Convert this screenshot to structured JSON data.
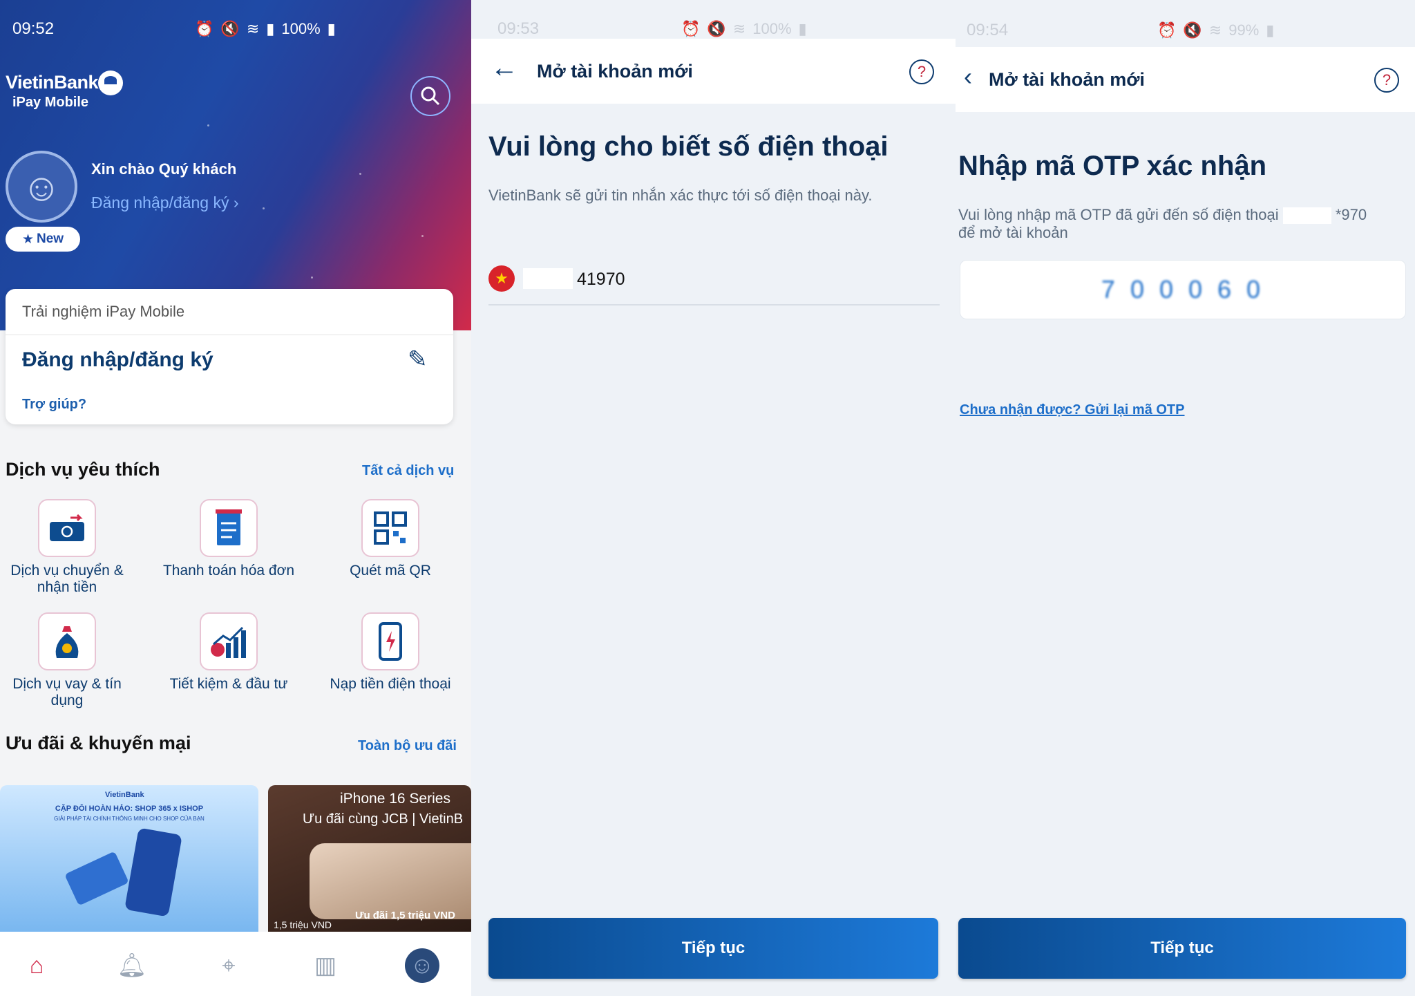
{
  "panel1": {
    "status_time": "09:52",
    "status_battery": "100%",
    "brand_name": "VietinBank",
    "brand_sub": "iPay Mobile",
    "greeting": "Xin chào Quý khách",
    "login_link": "Đăng nhập/đăng ký ›",
    "new_badge": "New",
    "card_subtitle": "Trải nghiệm iPay Mobile",
    "card_title": "Đăng nhập/đăng ký",
    "card_help": "Trợ giúp?",
    "fav_title": "Dịch vụ yêu thích",
    "fav_all": "Tất cả dịch vụ",
    "services": [
      {
        "label": "Dịch vụ chuyển & nhận tiền",
        "icon": "money-transfer-icon"
      },
      {
        "label": "Thanh toán hóa đơn",
        "icon": "bill-icon"
      },
      {
        "label": "Quét mã QR",
        "icon": "qr-code-icon"
      },
      {
        "label": "Dịch vụ vay & tín dụng",
        "icon": "money-bag-icon"
      },
      {
        "label": "Tiết kiệm & đầu tư",
        "icon": "savings-chart-icon"
      },
      {
        "label": "Nạp tiền điện thoại",
        "icon": "phone-topup-icon"
      }
    ],
    "promo_title": "Ưu đãi & khuyến mại",
    "promo_all": "Toàn bộ ưu đãi",
    "promo1_brand": "VietinBank",
    "promo1_line1": "CẶP ĐÔI HOÀN HẢO: SHOP 365 x ISHOP",
    "promo1_line2": "GIẢI PHÁP TÀI CHÍNH THÔNG MINH CHO SHOP CỦA BẠN",
    "promo2_line1": "iPhone 16 Series",
    "promo2_line2": "Ưu đãi cùng JCB | VietinB",
    "promo2_line3": "Ưu đãi 1,5 triệu VND",
    "promo2_line4": "1,5 triệu VND",
    "tabs": [
      "home-icon",
      "bell-icon",
      "location-icon",
      "chart-icon",
      "profile-icon"
    ]
  },
  "panel2": {
    "status_time": "09:53",
    "status_battery": "100%",
    "nav_title": "Mở tài khoản mới",
    "heading": "Vui lòng cho biết số điện thoại",
    "description": "VietinBank sẽ gửi tin nhắn xác thực tới số điện thoại này.",
    "phone_value": "41970",
    "button": "Tiếp tục"
  },
  "panel3": {
    "status_time": "09:54",
    "status_battery": "99%",
    "nav_title": "Mở tài khoản mới",
    "heading": "Nhập mã OTP xác nhận",
    "description_a": "Vui lòng nhập mã OTP đã gửi đến số điện thoại",
    "description_suffix": "*970",
    "description_b": "để mở tài khoản",
    "otp_value": "7 0 0 0 6 0",
    "resend": "Chưa nhận được? Gửi lại mã OTP",
    "button": "Tiếp tục"
  },
  "colors": {
    "primary": "#0d3b6e",
    "accent_blue": "#1d6ec9",
    "button_start": "#0a4a8f",
    "button_end": "#1d7ad9",
    "red": "#d12a4a"
  }
}
